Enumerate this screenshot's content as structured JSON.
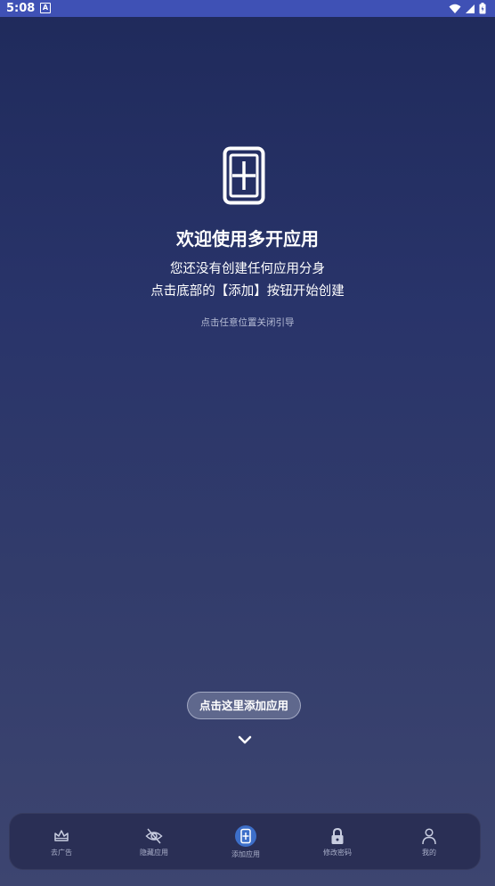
{
  "status_bar": {
    "time": "5:08",
    "badge": "A",
    "icons": [
      "wifi-icon",
      "signal-icon",
      "battery-icon"
    ]
  },
  "welcome": {
    "icon": "add-app-icon",
    "title": "欢迎使用多开应用",
    "line1": "您还没有创建任何应用分身",
    "line2": "点击底部的【添加】按钮开始创建",
    "close_hint": "点击任意位置关闭引导"
  },
  "tooltip": {
    "label": "点击这里添加应用",
    "icon": "chevron-down-icon"
  },
  "bottom_nav": {
    "items": [
      {
        "label": "去广告",
        "icon": "crown-icon",
        "active": false
      },
      {
        "label": "隐藏应用",
        "icon": "eye-off-icon",
        "active": false
      },
      {
        "label": "添加应用",
        "icon": "add-app-icon",
        "active": true
      },
      {
        "label": "修改密码",
        "icon": "lock-icon",
        "active": false
      },
      {
        "label": "我的",
        "icon": "person-icon",
        "active": false
      }
    ]
  },
  "colors": {
    "status_bar": "#3f51b5",
    "background_top": "#1f2a5b",
    "background_bottom": "#3d4570",
    "nav_background": "#2a2f55",
    "active_accent": "#3d6fc9"
  }
}
